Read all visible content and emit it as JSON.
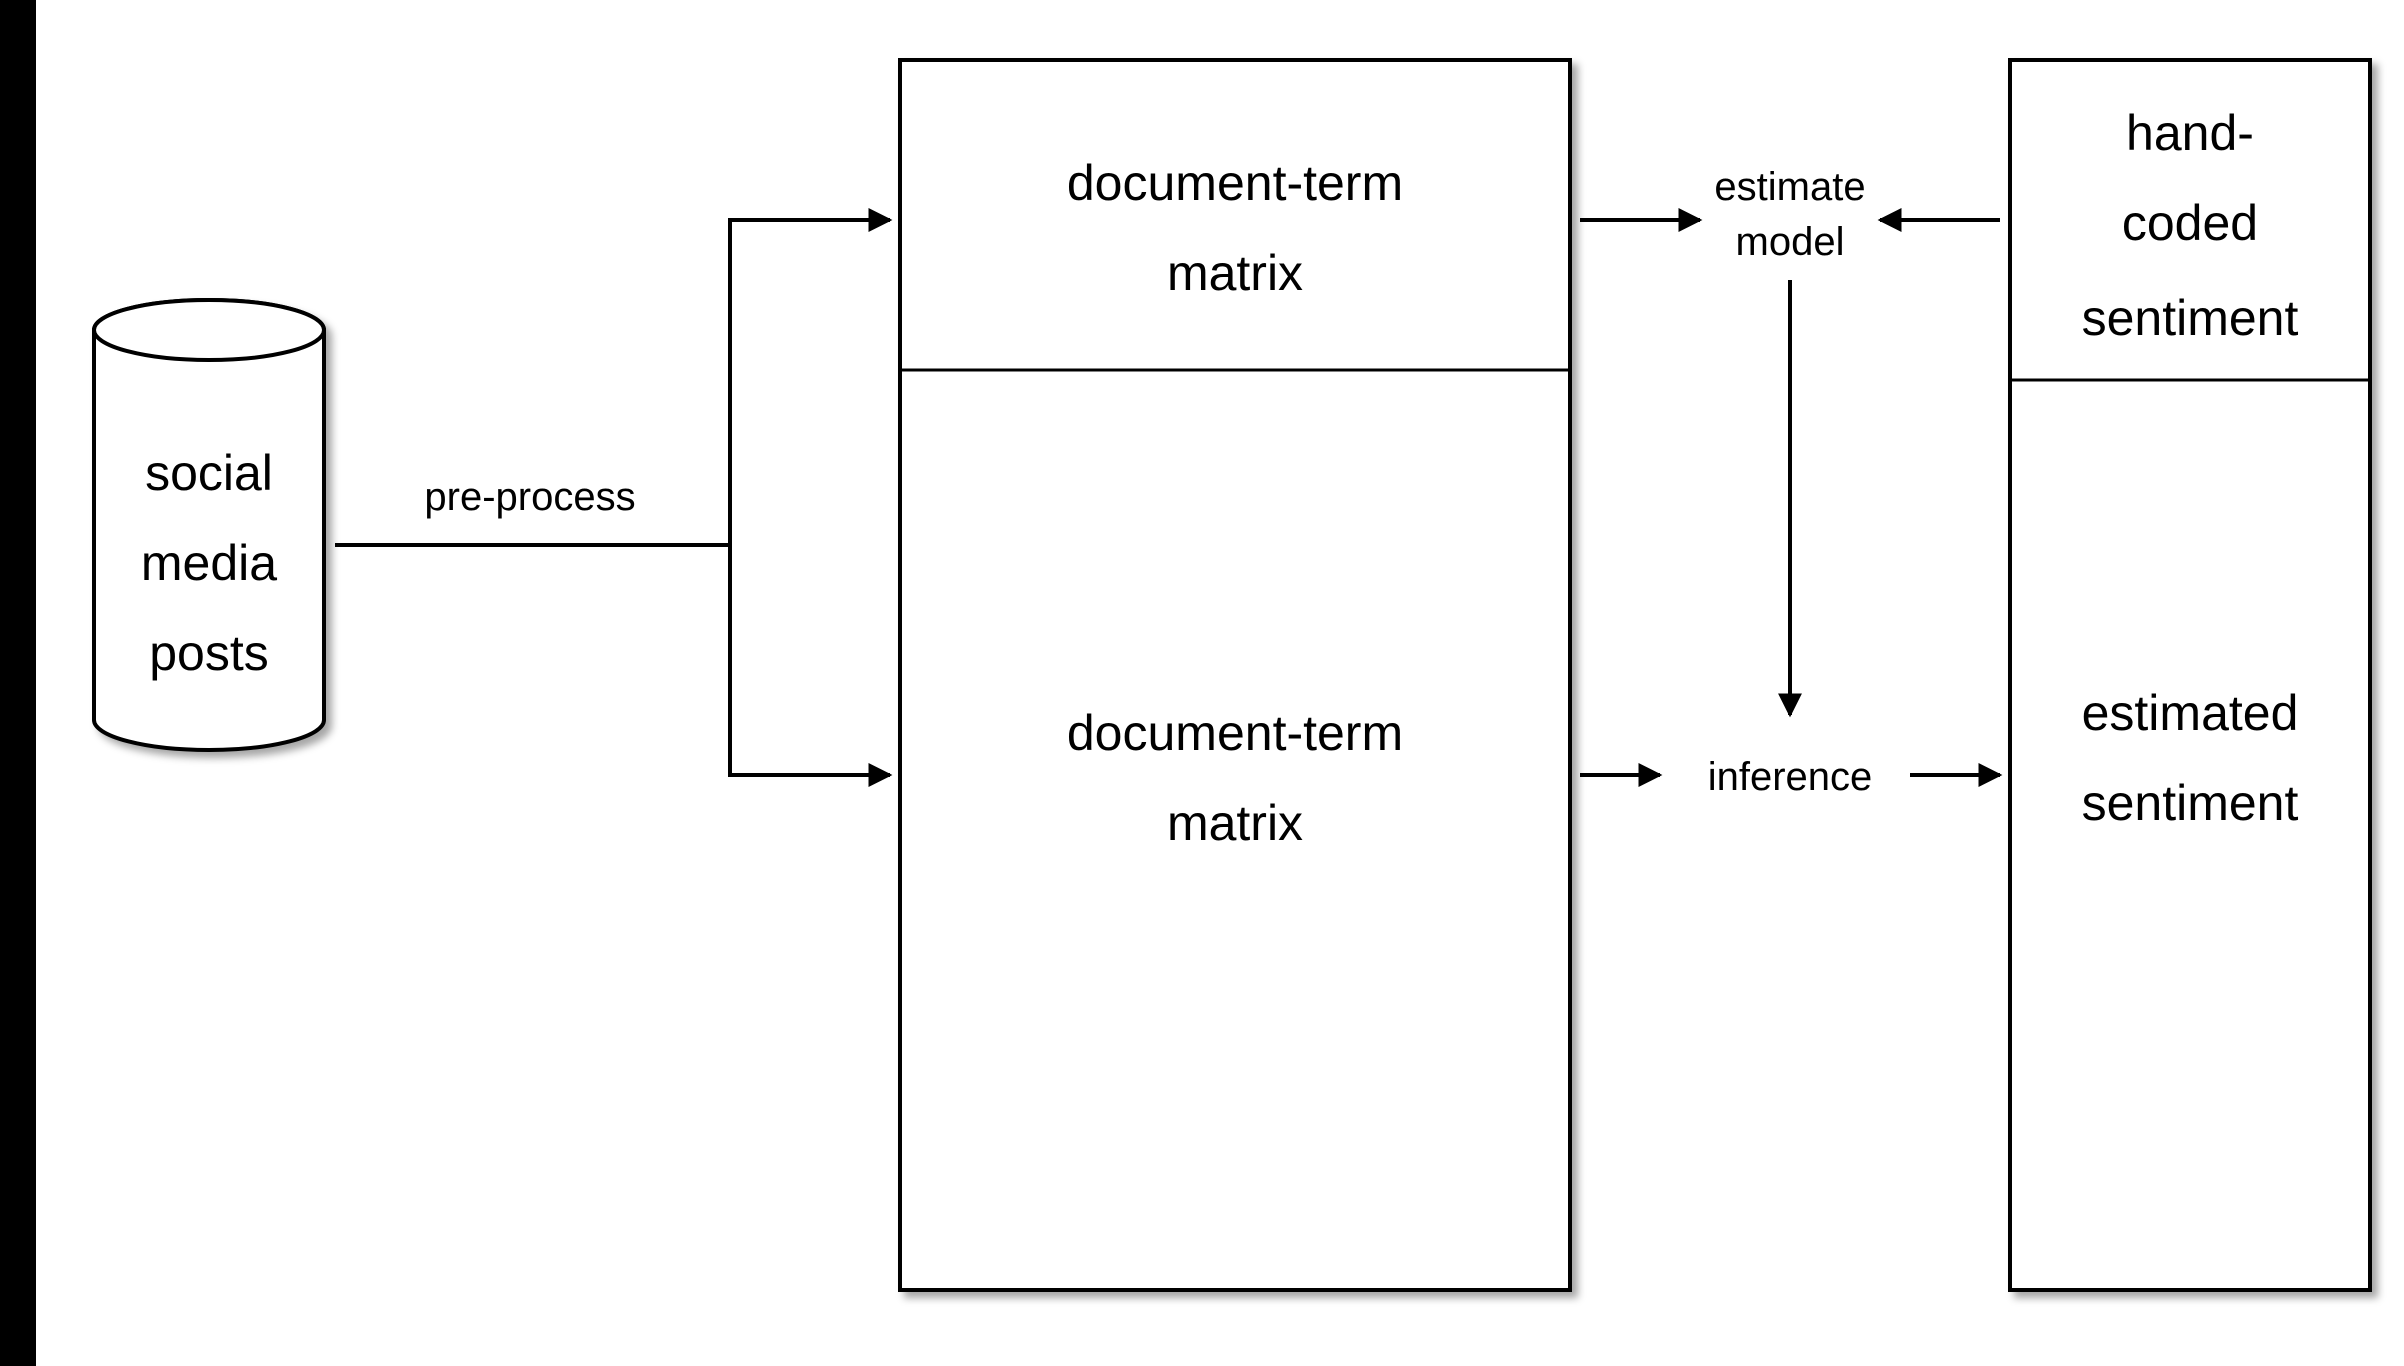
{
  "nodes": {
    "source": {
      "l1": "social",
      "l2": "media",
      "l3": "posts"
    },
    "dtm_top": {
      "l1": "document-term",
      "l2": "matrix"
    },
    "dtm_bot": {
      "l1": "document-term",
      "l2": "matrix"
    },
    "hand": {
      "l1": "hand-",
      "l2": "coded",
      "l3": "sentiment"
    },
    "est": {
      "l1": "estimated",
      "l2": "sentiment"
    }
  },
  "edges": {
    "preprocess": "pre-process",
    "estimate": {
      "l1": "estimate",
      "l2": "model"
    },
    "inference": "inference"
  }
}
